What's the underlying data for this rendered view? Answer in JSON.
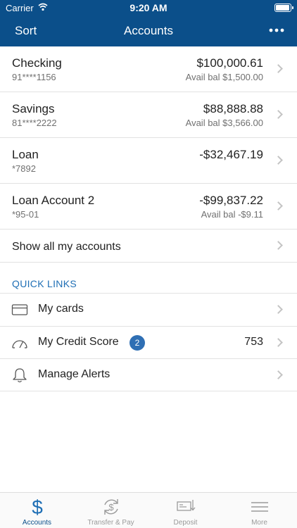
{
  "status": {
    "carrier": "Carrier",
    "time": "9:20 AM"
  },
  "nav": {
    "left_label": "Sort",
    "title": "Accounts"
  },
  "accounts": [
    {
      "name": "Checking",
      "number": "91****1156",
      "balance": "$100,000.61",
      "available": "Avail bal $1,500.00"
    },
    {
      "name": "Savings",
      "number": "81****2222",
      "balance": "$88,888.88",
      "available": "Avail bal $3,566.00"
    },
    {
      "name": "Loan",
      "number": "*7892",
      "balance": "-$32,467.19",
      "available": ""
    },
    {
      "name": "Loan Account 2",
      "number": "*95-01",
      "balance": "-$99,837.22",
      "available": "Avail bal -$9.11"
    }
  ],
  "show_all_label": "Show all my accounts",
  "quick_links": {
    "header": "QUICK LINKS",
    "items": [
      {
        "label": "My cards",
        "icon": "card-icon"
      },
      {
        "label": "My Credit Score",
        "icon": "gauge-icon",
        "badge": "2",
        "value": "753"
      },
      {
        "label": "Manage Alerts",
        "icon": "bell-icon"
      }
    ]
  },
  "tabs": [
    {
      "label": "Accounts",
      "icon": "dollar-icon",
      "active": true
    },
    {
      "label": "Transfer & Pay",
      "icon": "transfer-icon",
      "active": false
    },
    {
      "label": "Deposit",
      "icon": "check-deposit-icon",
      "active": false
    },
    {
      "label": "More",
      "icon": "menu-icon",
      "active": false
    }
  ],
  "colors": {
    "brand": "#0b4f8a",
    "accent": "#1f6fb5",
    "badge": "#2f6fb4"
  }
}
